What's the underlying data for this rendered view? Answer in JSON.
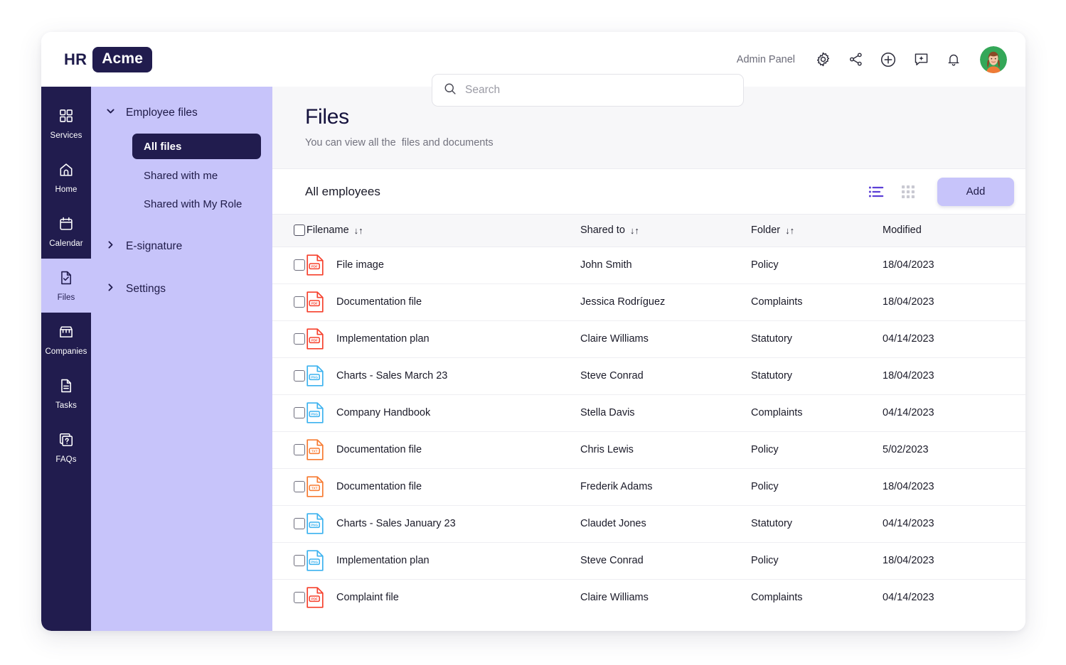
{
  "brand": {
    "prefix": "HR",
    "name": "Acme"
  },
  "search": {
    "placeholder": "Search",
    "value": "",
    "icon": "search-icon"
  },
  "header": {
    "admin_panel": "Admin Panel",
    "icons": [
      "gear-icon",
      "share-icon",
      "plus-circle-icon",
      "chat-sparkle-icon",
      "bell-icon"
    ],
    "avatar": "user-avatar"
  },
  "rail": {
    "items": [
      {
        "label": "Services",
        "icon": "grid-squares-icon",
        "active": false
      },
      {
        "label": "Home",
        "icon": "home-icon",
        "active": false
      },
      {
        "label": "Calendar",
        "icon": "calendar-icon",
        "active": false
      },
      {
        "label": "Files",
        "icon": "file-check-icon",
        "active": true
      },
      {
        "label": "Companies",
        "icon": "storefront-icon",
        "active": false
      },
      {
        "label": "Tasks",
        "icon": "document-lines-icon",
        "active": false
      },
      {
        "label": "FAQs",
        "icon": "question-card-icon",
        "active": false
      }
    ]
  },
  "subnav": {
    "groups": [
      {
        "label": "Employee files",
        "expanded": true,
        "chevron": "chevron-down-icon"
      },
      {
        "label": "E-signature",
        "expanded": false,
        "chevron": "chevron-right-icon"
      },
      {
        "label": "Settings",
        "expanded": false,
        "chevron": "chevron-right-icon"
      }
    ],
    "items": [
      {
        "label": "All files",
        "active": true
      },
      {
        "label": "Shared with me",
        "active": false
      },
      {
        "label": "Shared with My Role",
        "active": false
      }
    ]
  },
  "page": {
    "title": "Files",
    "subtitle": "You can view all the  files and documents"
  },
  "toolbar": {
    "title": "All employees",
    "list_view_icon": "list-view-icon",
    "grid_view_icon": "grid-view-icon",
    "add_label": "Add"
  },
  "table": {
    "headers": {
      "filename": "Filename",
      "shared_to": "Shared to",
      "folder": "Folder",
      "modified": "Modified"
    },
    "sort_glyph": "↓↑",
    "rows": [
      {
        "filename": "File image",
        "type": "pdf",
        "shared_to": "John Smith",
        "folder": "Policy",
        "modified": "18/04/2023"
      },
      {
        "filename": "Documentation file",
        "type": "pdf",
        "shared_to": "Jessica Rodríguez",
        "folder": "Complaints",
        "modified": "18/04/2023"
      },
      {
        "filename": "Implementation plan",
        "type": "pdf",
        "shared_to": "Claire Williams",
        "folder": "Statutory",
        "modified": "04/14/2023"
      },
      {
        "filename": "Charts - Sales March 23",
        "type": "png",
        "shared_to": "Steve Conrad",
        "folder": "Statutory",
        "modified": "18/04/2023"
      },
      {
        "filename": "Company Handbook",
        "type": "png",
        "shared_to": "Stella Davis",
        "folder": "Complaints",
        "modified": "04/14/2023"
      },
      {
        "filename": "Documentation file",
        "type": "txt",
        "shared_to": "Chris Lewis",
        "folder": "Policy",
        "modified": "5/02/2023"
      },
      {
        "filename": "Documentation file",
        "type": "txt",
        "shared_to": "Frederik Adams",
        "folder": "Policy",
        "modified": "18/04/2023"
      },
      {
        "filename": "Charts - Sales January 23",
        "type": "png",
        "shared_to": "Claudet Jones",
        "folder": "Statutory",
        "modified": "04/14/2023"
      },
      {
        "filename": "Implementation plan",
        "type": "png",
        "shared_to": "Steve Conrad",
        "folder": "Policy",
        "modified": "18/04/2023"
      },
      {
        "filename": "Complaint file",
        "type": "pdf",
        "shared_to": "Claire Williams",
        "folder": "Complaints",
        "modified": "04/14/2023"
      }
    ]
  },
  "colors": {
    "navy": "#211c4e",
    "lavender": "#c7c4fa",
    "pdf": "#f6402c",
    "txt": "#f77a30",
    "png": "#3cb2ef",
    "accent": "#5b3fd6"
  }
}
